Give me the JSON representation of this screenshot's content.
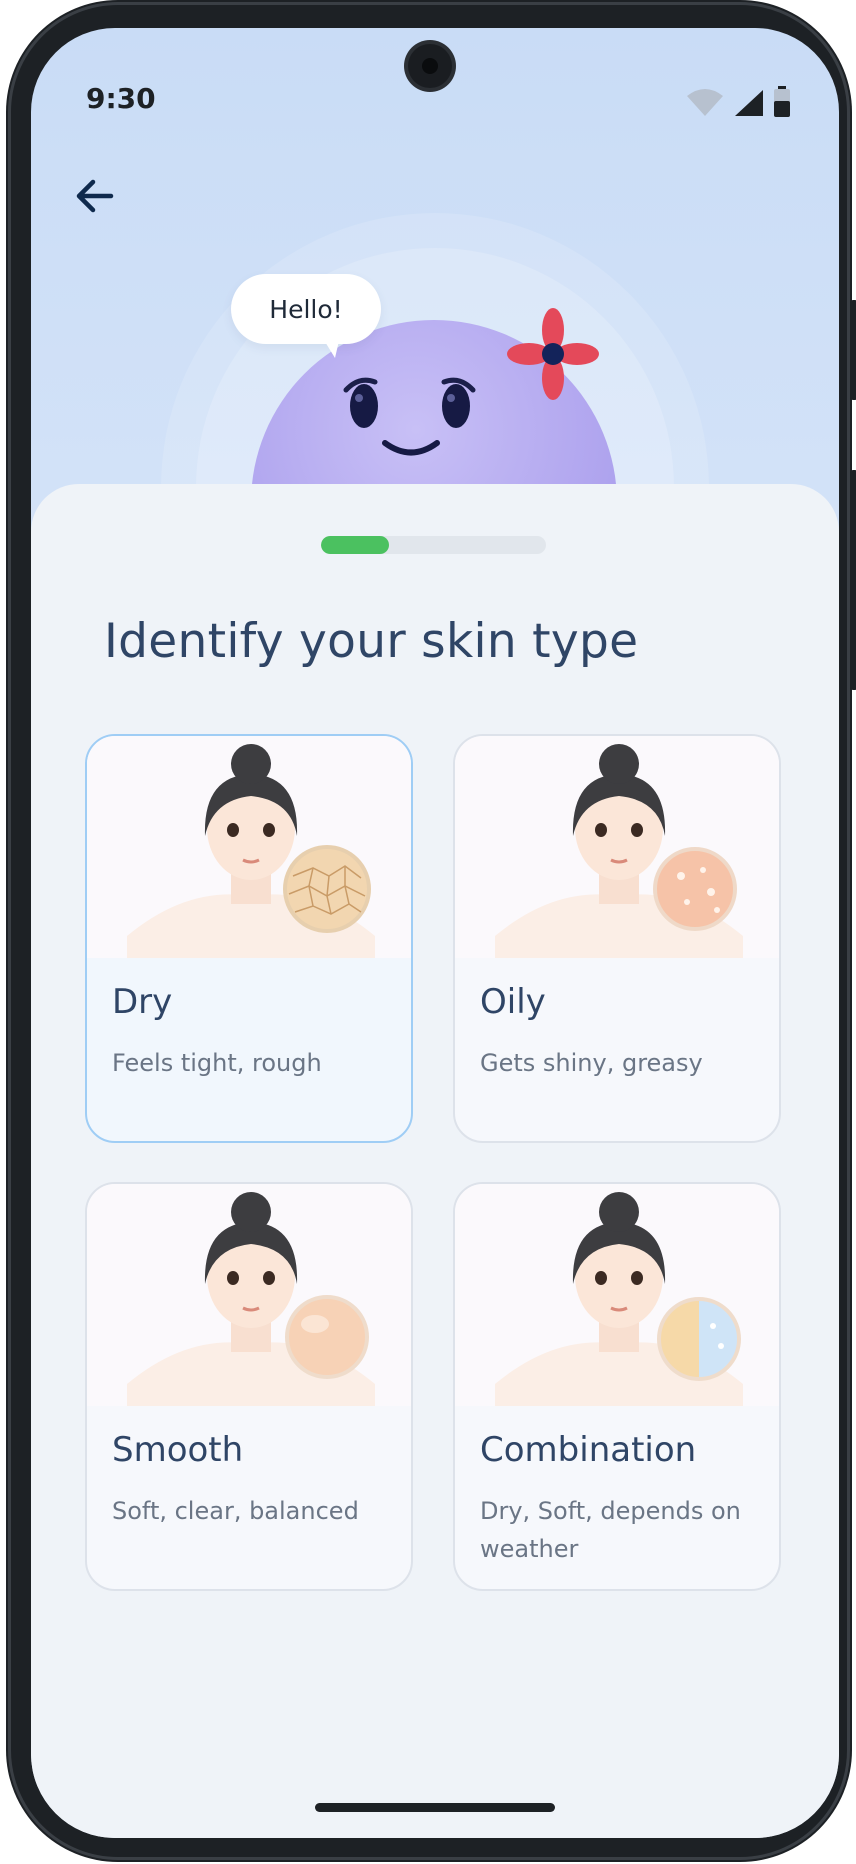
{
  "status_bar": {
    "time": "9:30"
  },
  "navigation": {
    "back_icon": "arrow-left-icon"
  },
  "mascot": {
    "greeting": "Hello!"
  },
  "progress": {
    "value": 0.3
  },
  "title": "Identify your skin type",
  "options": [
    {
      "title": "Dry",
      "description": "Feels tight, rough",
      "selected": true,
      "swatch": "cracked-dry-skin-texture"
    },
    {
      "title": "Oily",
      "description": "Gets shiny, greasy",
      "selected": false,
      "swatch": "glossy-oily-skin-texture"
    },
    {
      "title": "Smooth",
      "description": "Soft, clear, balanced",
      "selected": false,
      "swatch": "smooth-skin-texture"
    },
    {
      "title": "Combination",
      "description": "Dry, Soft, depends on weather",
      "selected": false,
      "swatch": "half-dry-half-oily-texture"
    }
  ],
  "colors": {
    "accent_green": "#4bc160",
    "title_text": "#2f4566",
    "selected_border": "#9fcdf5",
    "mascot_purple": "#b1a6ef"
  }
}
